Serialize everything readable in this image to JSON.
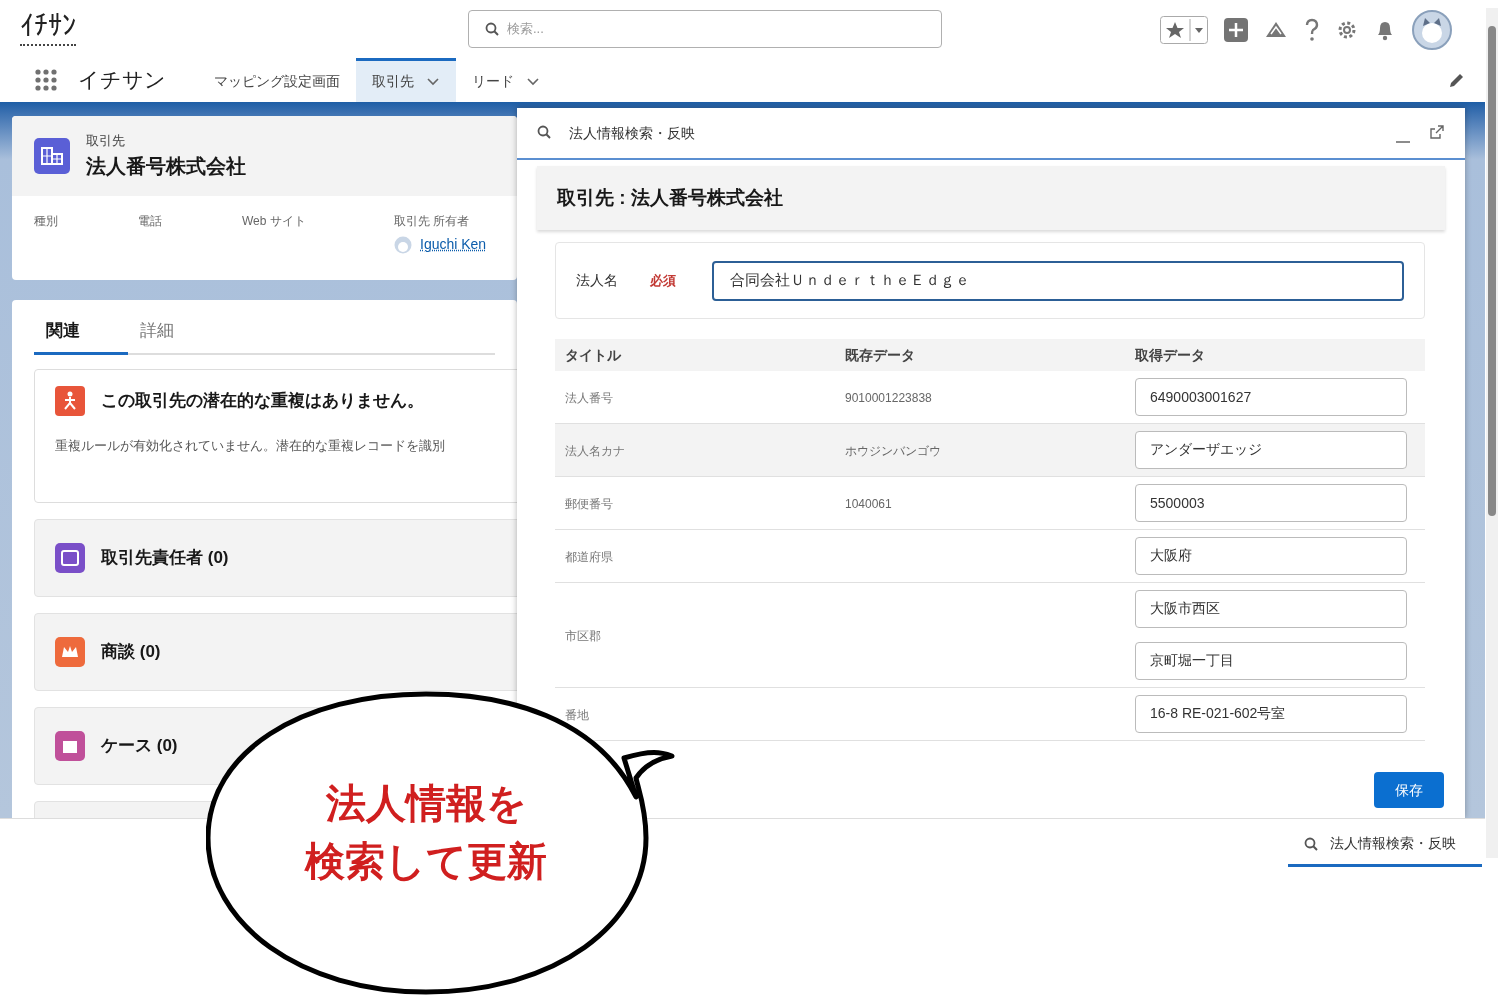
{
  "header": {
    "logo": "ｲﾁｻﾝ",
    "search": {
      "placeholder": "検索..."
    }
  },
  "nav": {
    "app_name": "イチサン",
    "tabs": [
      {
        "label": "マッピング設定画面",
        "selected": false,
        "dropdown": false
      },
      {
        "label": "取引先",
        "selected": true,
        "dropdown": true
      },
      {
        "label": "リード",
        "selected": false,
        "dropdown": true
      }
    ]
  },
  "record": {
    "object_label": "取引先",
    "title": "法人番号株式会社",
    "fields": [
      {
        "label": "種別"
      },
      {
        "label": "電話"
      },
      {
        "label": "Web サイト"
      },
      {
        "label": "取引先 所有者",
        "value": "Iguchi Ken"
      }
    ]
  },
  "related": {
    "tabs": [
      {
        "label": "関連",
        "selected": true
      },
      {
        "label": "詳細",
        "selected": false
      }
    ],
    "duplicates": {
      "title": "この取引先の潜在的な重複はありません。",
      "body": "重複ルールが有効化されていません。潜在的な重複レコードを識別"
    },
    "lists": [
      {
        "title": "取引先責任者 (0)",
        "color": "#7a4fc8"
      },
      {
        "title": "商談 (0)",
        "color": "#ee6a3c"
      },
      {
        "title": "ケース (0)",
        "color": "#c0509a"
      }
    ]
  },
  "panel": {
    "title": "法人情報検索・反映",
    "heading": "取引先 : 法人番号株式会社",
    "name_field": {
      "label": "法人名",
      "required_label": "必須",
      "value": "合同会社ＵｎｄｅｒｔｈｅＥｄｇｅ"
    },
    "table": {
      "columns": [
        "タイトル",
        "既存データ",
        "取得データ"
      ],
      "rows": [
        {
          "title": "法人番号",
          "existing": "9010001223838",
          "fetched": [
            "6490003001627"
          ],
          "hovered": false
        },
        {
          "title": "法人名カナ",
          "existing": "ホウジンバンゴウ",
          "fetched": [
            "アンダーザエッジ"
          ],
          "hovered": true
        },
        {
          "title": "郵便番号",
          "existing": "1040061",
          "fetched": [
            "5500003"
          ],
          "hovered": false
        },
        {
          "title": "都道府県",
          "fetched": [
            "大阪府"
          ],
          "hovered": false
        },
        {
          "title": "市区郡",
          "fetched": [
            "大阪市西区",
            "京町堀一丁目"
          ],
          "hovered": false
        },
        {
          "title": "番地",
          "fetched": [
            "16-8 RE-021-602号室"
          ],
          "hovered": false
        }
      ]
    },
    "save_button": "保存"
  },
  "utility_bar": {
    "item": "法人情報検索・反映"
  },
  "callout": {
    "lines": [
      "法人情報を",
      "検索して更新"
    ]
  }
}
